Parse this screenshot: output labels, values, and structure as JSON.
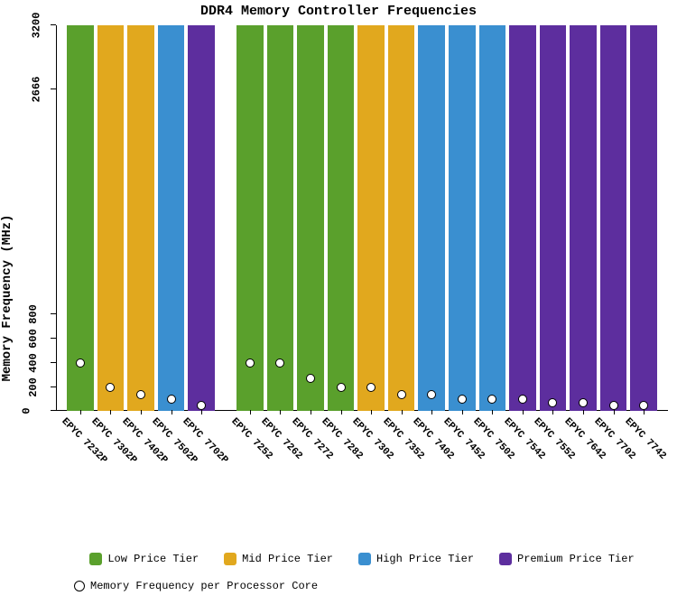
{
  "chart_data": {
    "type": "bar",
    "title": "DDR4 Memory Controller Frequencies",
    "ylabel": "Memory Frequency (MHz)",
    "xlabel": "",
    "y_ticks": [
      0,
      200,
      400,
      600,
      800,
      2666,
      3200
    ],
    "ylim": [
      0,
      3200
    ],
    "colors": {
      "low": "#5aa02c",
      "mid": "#e1a81e",
      "high": "#3a8fd0",
      "premium": "#5d2e9e"
    },
    "groups": [
      {
        "items": [
          {
            "label": "EPYC 7232P",
            "bar": 3200,
            "dot": 400,
            "tier": "low"
          },
          {
            "label": "EPYC 7302P",
            "bar": 3200,
            "dot": 200,
            "tier": "mid"
          },
          {
            "label": "EPYC 7402P",
            "bar": 3200,
            "dot": 135,
            "tier": "mid"
          },
          {
            "label": "EPYC 7502P",
            "bar": 3200,
            "dot": 100,
            "tier": "high"
          },
          {
            "label": "EPYC 7702P",
            "bar": 3200,
            "dot": 50,
            "tier": "premium"
          }
        ]
      },
      {
        "items": [
          {
            "label": "EPYC 7252",
            "bar": 3200,
            "dot": 400,
            "tier": "low"
          },
          {
            "label": "EPYC 7262",
            "bar": 3200,
            "dot": 400,
            "tier": "low"
          },
          {
            "label": "EPYC 7272",
            "bar": 3200,
            "dot": 270,
            "tier": "low"
          },
          {
            "label": "EPYC 7282",
            "bar": 3200,
            "dot": 200,
            "tier": "low"
          },
          {
            "label": "EPYC 7302",
            "bar": 3200,
            "dot": 200,
            "tier": "mid"
          },
          {
            "label": "EPYC 7352",
            "bar": 3200,
            "dot": 135,
            "tier": "mid"
          },
          {
            "label": "EPYC 7402",
            "bar": 3200,
            "dot": 135,
            "tier": "high"
          },
          {
            "label": "EPYC 7452",
            "bar": 3200,
            "dot": 100,
            "tier": "high"
          },
          {
            "label": "EPYC 7502",
            "bar": 3200,
            "dot": 100,
            "tier": "high"
          },
          {
            "label": "EPYC 7542",
            "bar": 3200,
            "dot": 100,
            "tier": "premium"
          },
          {
            "label": "EPYC 7552",
            "bar": 3200,
            "dot": 70,
            "tier": "premium"
          },
          {
            "label": "EPYC 7642",
            "bar": 3200,
            "dot": 70,
            "tier": "premium"
          },
          {
            "label": "EPYC 7702",
            "bar": 3200,
            "dot": 50,
            "tier": "premium"
          },
          {
            "label": "EPYC 7742",
            "bar": 3200,
            "dot": 50,
            "tier": "premium"
          }
        ]
      }
    ],
    "legend": {
      "low": "Low Price Tier",
      "mid": "Mid Price Tier",
      "high": "High Price Tier",
      "premium": "Premium Price Tier",
      "dot": "Memory Frequency per Processor Core"
    }
  }
}
